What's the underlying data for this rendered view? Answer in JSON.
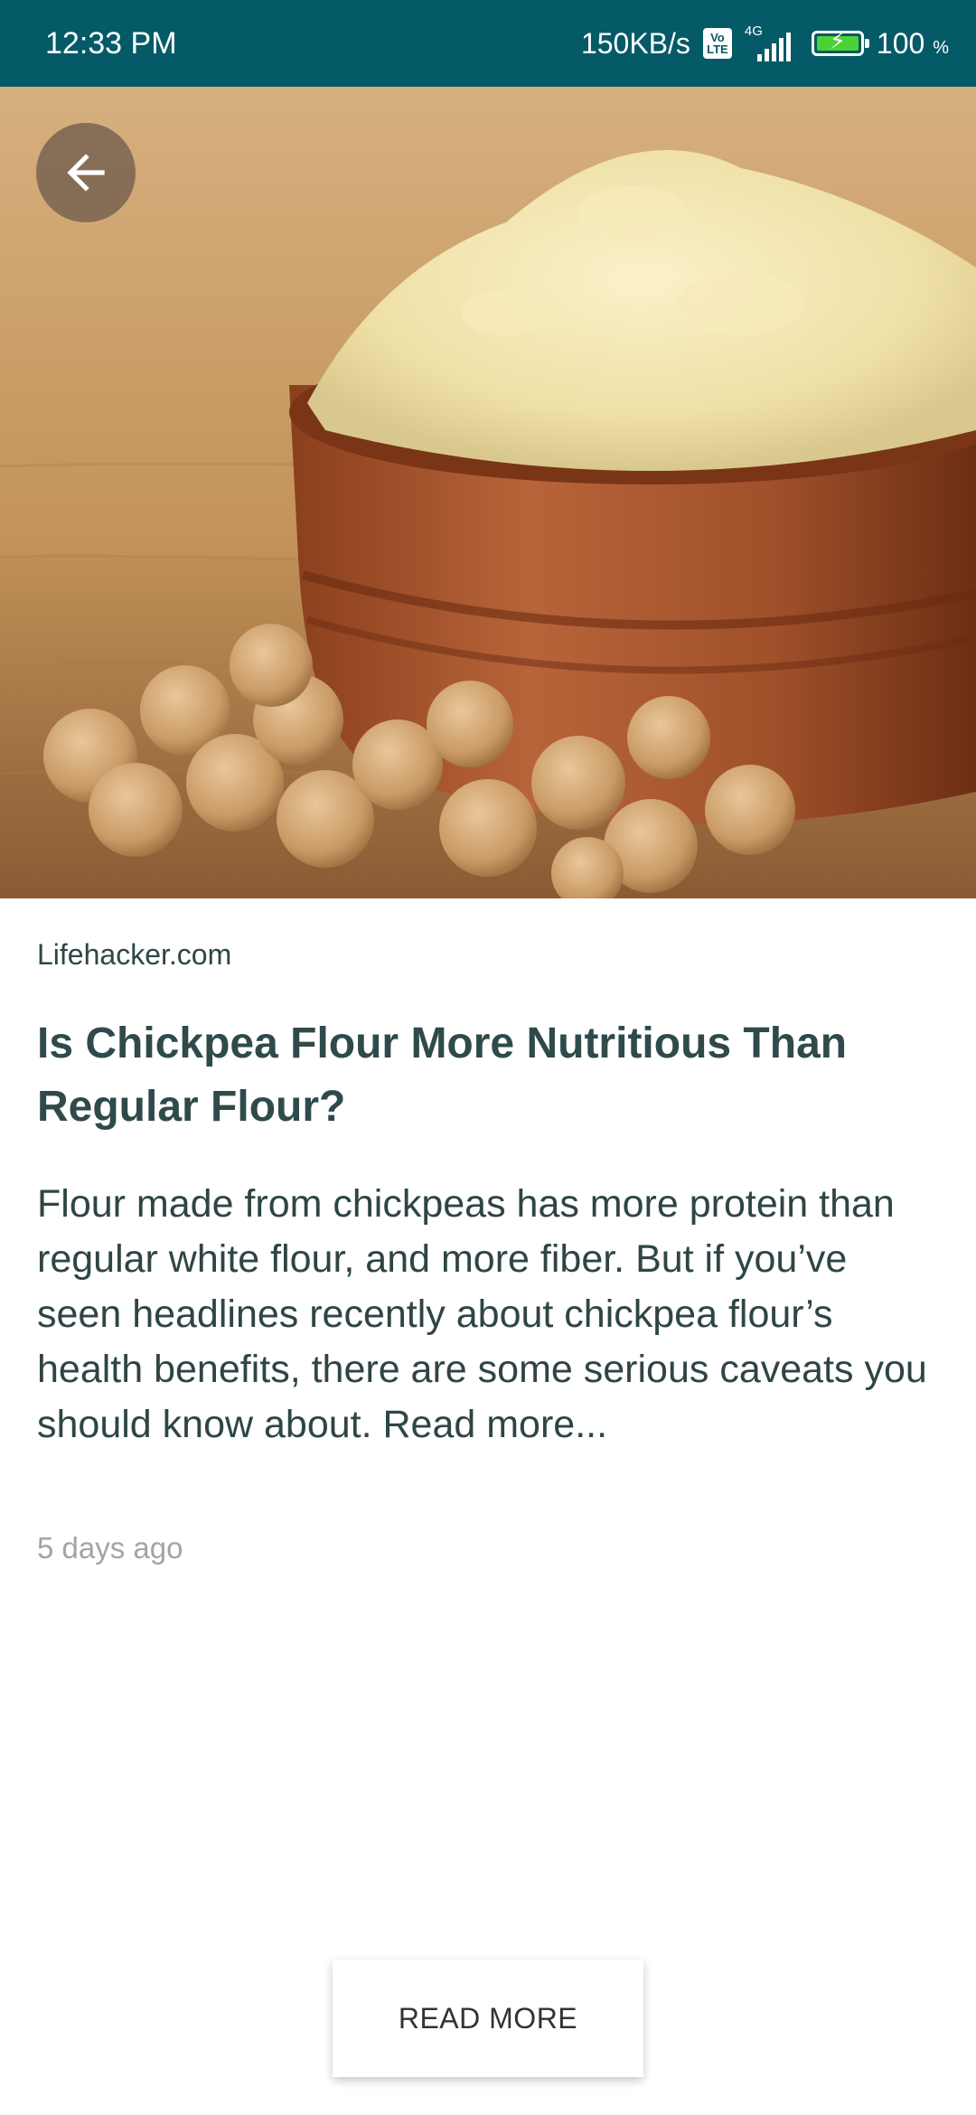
{
  "status_bar": {
    "time": "12:33 PM",
    "network_speed": "150KB/s",
    "volte_label": "Vo LTE",
    "network_type": "4G",
    "battery_percent": "100",
    "battery_unit": "%"
  },
  "hero": {
    "back_icon": "arrow-left-icon",
    "image_subject": "chickpea-flour-bowl"
  },
  "article": {
    "source": "Lifehacker.com",
    "title": "Is Chickpea Flour More Nutritious Than Regular Flour?",
    "description": "Flour made from chickpeas has more protein than regular white flour, and more fiber. But if you’ve seen headlines recently about chickpea flour’s health benefits, there are some serious caveats you should know about. Read more...",
    "time_ago": "5 days ago"
  },
  "actions": {
    "read_more_label": "READ MORE"
  },
  "colors": {
    "status_bar_bg": "#045a66",
    "title_text": "#2f4a4a",
    "body_text": "#2f4545",
    "meta_text": "#a4a4a4"
  }
}
